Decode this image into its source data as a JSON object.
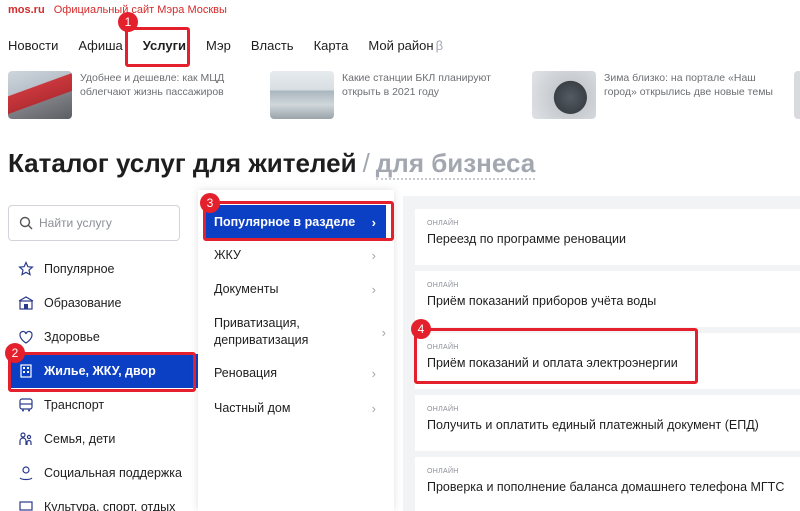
{
  "topbar": {
    "logo": "mos.ru",
    "official": "Официальный сайт Мэра Москвы"
  },
  "nav": [
    {
      "label": "Новости",
      "active": false
    },
    {
      "label": "Афиша",
      "active": false
    },
    {
      "label": "Услуги",
      "active": true
    },
    {
      "label": "Мэр",
      "active": false
    },
    {
      "label": "Власть",
      "active": false
    },
    {
      "label": "Карта",
      "active": false
    },
    {
      "label": "Мой район",
      "active": false,
      "beta": "β"
    }
  ],
  "news": [
    {
      "text": "Удобнее и дешевле: как МЦД облегчают жизнь пассажиров"
    },
    {
      "text": "Какие станции БКЛ планируют открыть в 2021 году"
    },
    {
      "text": "Зима близко: на портале «Наш город» открылись две новые темы"
    }
  ],
  "title": {
    "residents": "Каталог услуг для жителей",
    "separator": "/",
    "business": "для бизнеса"
  },
  "search": {
    "placeholder": "Найти услугу"
  },
  "categories": [
    {
      "label": "Популярное",
      "icon": "star-icon"
    },
    {
      "label": "Образование",
      "icon": "education-icon"
    },
    {
      "label": "Здоровье",
      "icon": "health-icon"
    },
    {
      "label": "Жилье, ЖКУ, двор",
      "icon": "building-icon",
      "active": true
    },
    {
      "label": "Транспорт",
      "icon": "bus-icon"
    },
    {
      "label": "Семья, дети",
      "icon": "family-icon"
    },
    {
      "label": "Социальная поддержка",
      "icon": "support-icon"
    },
    {
      "label": "Культура, спорт, отдых",
      "icon": "culture-icon"
    }
  ],
  "subcategories": [
    {
      "label": "Популярное в разделе",
      "active": true
    },
    {
      "label": "ЖКУ"
    },
    {
      "label": "Документы"
    },
    {
      "label": "Приватизация, деприватизация"
    },
    {
      "label": "Реновация"
    },
    {
      "label": "Частный дом"
    }
  ],
  "services": [
    {
      "tag": "ОНЛАЙН",
      "name": "Переезд по программе реновации"
    },
    {
      "tag": "ОНЛАЙН",
      "name": "Приём показаний приборов учёта воды"
    },
    {
      "tag": "ОНЛАЙН",
      "name": "Приём показаний и оплата электроэнергии"
    },
    {
      "tag": "ОНЛАЙН",
      "name": "Получить и оплатить единый платежный документ (ЕПД)"
    },
    {
      "tag": "ОНЛАЙН",
      "name": "Проверка и пополнение баланса домашнего телефона МГТС"
    }
  ],
  "annotations": [
    "1",
    "2",
    "3",
    "4"
  ],
  "colors": {
    "accent": "#0b3fc4",
    "annotation": "#e3202b",
    "brand": "#d42a2a"
  }
}
